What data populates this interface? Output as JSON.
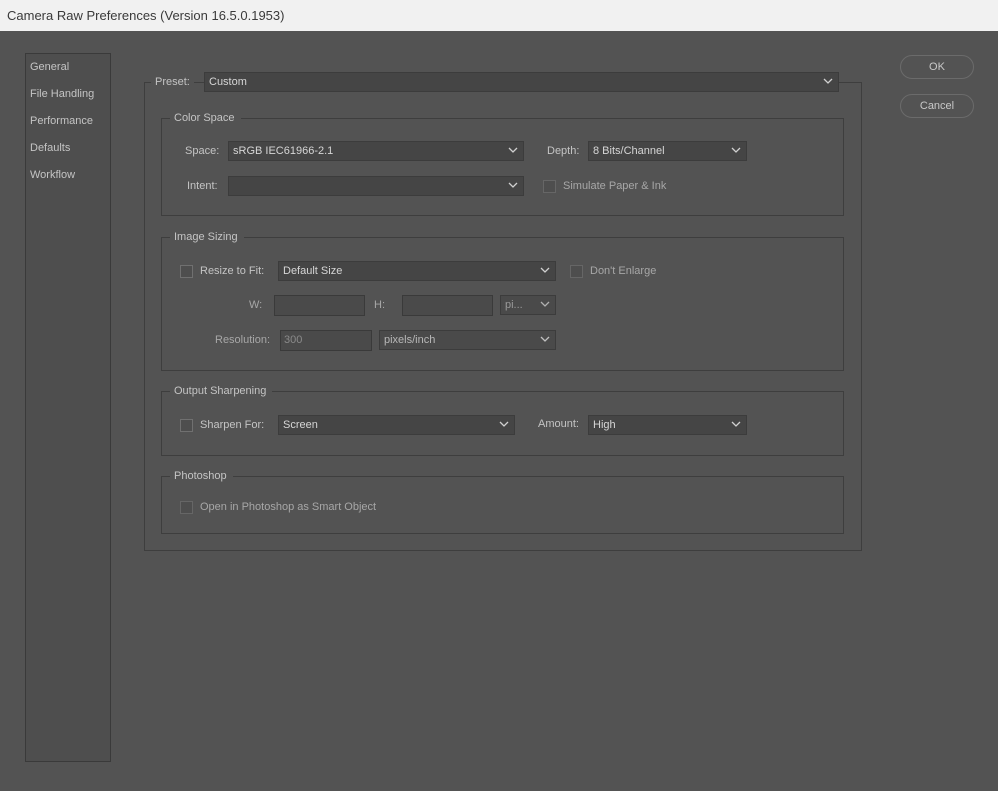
{
  "window": {
    "title": "Camera Raw Preferences  (Version 16.5.0.1953)"
  },
  "sidebar": {
    "items": [
      {
        "label": "General"
      },
      {
        "label": "File Handling"
      },
      {
        "label": "Performance"
      },
      {
        "label": "Defaults"
      },
      {
        "label": "Workflow"
      }
    ]
  },
  "buttons": {
    "ok": "OK",
    "cancel": "Cancel"
  },
  "preset": {
    "label": "Preset:",
    "value": "Custom"
  },
  "color_space": {
    "legend": "Color Space",
    "space_label": "Space:",
    "space_value": "sRGB IEC61966-2.1",
    "depth_label": "Depth:",
    "depth_value": "8 Bits/Channel",
    "intent_label": "Intent:",
    "intent_value": "",
    "simulate_label": "Simulate Paper & Ink"
  },
  "image_sizing": {
    "legend": "Image Sizing",
    "resize_label": "Resize to Fit:",
    "resize_value": "Default Size",
    "dont_enlarge_label": "Don't Enlarge",
    "w_label": "W:",
    "w_value": "",
    "h_label": "H:",
    "h_value": "",
    "unit_value": "pi...",
    "resolution_label": "Resolution:",
    "resolution_value": "300",
    "resolution_unit": "pixels/inch"
  },
  "output_sharpening": {
    "legend": "Output Sharpening",
    "sharpen_label": "Sharpen For:",
    "sharpen_value": "Screen",
    "amount_label": "Amount:",
    "amount_value": "High"
  },
  "photoshop": {
    "legend": "Photoshop",
    "smart_object_label": "Open in Photoshop as Smart Object"
  }
}
